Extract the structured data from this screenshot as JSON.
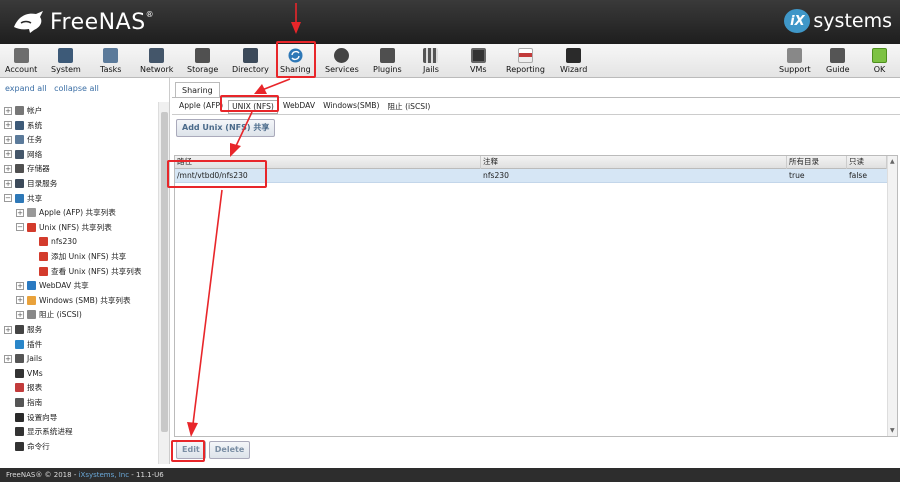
{
  "header": {
    "brand": "FreeNAS",
    "brand_tm": "®",
    "partner_mark": "iX",
    "partner_text": "systems"
  },
  "toolbar": {
    "items": [
      {
        "label": "Account",
        "icon": "account-icon",
        "color": "#6d6d6d"
      },
      {
        "label": "System",
        "icon": "system-icon",
        "color": "#3d5a78"
      },
      {
        "label": "Tasks",
        "icon": "tasks-icon",
        "color": "#5b7a9a"
      },
      {
        "label": "Network",
        "icon": "network-icon",
        "color": "#44566a"
      },
      {
        "label": "Storage",
        "icon": "storage-icon",
        "color": "#505050"
      },
      {
        "label": "Directory",
        "icon": "directory-icon",
        "color": "#3c4a5a"
      },
      {
        "label": "Sharing",
        "icon": "sharing-icon",
        "color": "#2e78b7"
      },
      {
        "label": "Services",
        "icon": "services-icon",
        "color": "#444444"
      },
      {
        "label": "Plugins",
        "icon": "plugins-icon",
        "color": "#4f4f4f"
      },
      {
        "label": "Jails",
        "icon": "jails-icon",
        "color": "#555555"
      },
      {
        "label": "VMs",
        "icon": "vms-icon",
        "color": "#333333"
      },
      {
        "label": "Reporting",
        "icon": "reporting-icon",
        "color": "#c23b3b"
      },
      {
        "label": "Wizard",
        "icon": "wizard-icon",
        "color": "#2a2a2a"
      },
      {
        "label": "Support",
        "icon": "support-icon",
        "color": "#777777"
      },
      {
        "label": "Guide",
        "icon": "guide-icon",
        "color": "#555555"
      },
      {
        "label": "OK",
        "icon": "ok-icon",
        "color": "#7cc242"
      }
    ]
  },
  "sidebar": {
    "expand_all": "expand all",
    "collapse_all": "collapse all",
    "tree": [
      {
        "label": "帐户",
        "icon": "account-icon",
        "color": "#777777",
        "expander": "+"
      },
      {
        "label": "系统",
        "icon": "system-icon",
        "color": "#3d5a78",
        "expander": "+"
      },
      {
        "label": "任务",
        "icon": "tasks-icon",
        "color": "#5b7a9a",
        "expander": "+"
      },
      {
        "label": "网络",
        "icon": "network-icon",
        "color": "#44566a",
        "expander": "+"
      },
      {
        "label": "存储器",
        "icon": "storage-icon",
        "color": "#505050",
        "expander": "+"
      },
      {
        "label": "目录服务",
        "icon": "directory-icon",
        "color": "#3c4a5a",
        "expander": "+"
      },
      {
        "label": "共享",
        "icon": "sharing-icon",
        "color": "#2e78b7",
        "expander": "−"
      },
      {
        "label": "Apple (AFP) 共享列表",
        "icon": "apple-icon",
        "color": "#999999",
        "expander": "+"
      },
      {
        "label": "Unix (NFS) 共享列表",
        "icon": "unix-icon",
        "color": "#d33b2c",
        "expander": "−"
      },
      {
        "label": "nfs230",
        "icon": "unix-share-icon",
        "color": "#d33b2c",
        "expander": ""
      },
      {
        "label": "添加 Unix (NFS) 共享",
        "icon": "add-share-icon",
        "color": "#d33b2c",
        "expander": ""
      },
      {
        "label": "查看 Unix (NFS) 共享列表",
        "icon": "view-share-icon",
        "color": "#d33b2c",
        "expander": ""
      },
      {
        "label": "WebDAV 共享",
        "icon": "webdav-icon",
        "color": "#2a7ac2",
        "expander": "+"
      },
      {
        "label": "Windows (SMB) 共享列表",
        "icon": "windows-icon",
        "color": "#e9a23b",
        "expander": "+"
      },
      {
        "label": "阻止 (iSCSI)",
        "icon": "iscsi-icon",
        "color": "#888888",
        "expander": "+"
      },
      {
        "label": "服务",
        "icon": "services-icon",
        "color": "#444444",
        "expander": "+"
      },
      {
        "label": "插件",
        "icon": "plugins-icon",
        "color": "#2a86c9",
        "expander": ""
      },
      {
        "label": "Jails",
        "icon": "jails-icon",
        "color": "#555555",
        "expander": "+"
      },
      {
        "label": "VMs",
        "icon": "vms-icon",
        "color": "#333333",
        "expander": ""
      },
      {
        "label": "报表",
        "icon": "reporting-icon",
        "color": "#c23b3b",
        "expander": ""
      },
      {
        "label": "指南",
        "icon": "guide-icon",
        "color": "#555555",
        "expander": ""
      },
      {
        "label": "设置向导",
        "icon": "wizard-icon",
        "color": "#2a2a2a",
        "expander": ""
      },
      {
        "label": "显示系统进程",
        "icon": "process-icon",
        "color": "#333333",
        "expander": ""
      },
      {
        "label": "命令行",
        "icon": "shell-icon",
        "color": "#333333",
        "expander": ""
      }
    ]
  },
  "main": {
    "tab_label": "Sharing",
    "subtabs": [
      {
        "label": "Apple (AFP)",
        "active": false
      },
      {
        "label": "UNIX (NFS)",
        "active": true
      },
      {
        "label": "WebDAV",
        "active": false
      },
      {
        "label": "Windows(SMB)",
        "active": false
      },
      {
        "label": "阻止 (iSCSI)",
        "active": false
      }
    ],
    "add_button": "Add Unix (NFS) 共享",
    "columns": [
      "路径",
      "注释",
      "所有目录",
      "只读"
    ],
    "rows": [
      [
        "/mnt/vtbd0/nfs230",
        "nfs230",
        "true",
        "false"
      ]
    ],
    "edit_button": "Edit",
    "delete_button": "Delete"
  },
  "footer": {
    "copyright": "FreeNAS® © 2018 - ",
    "company": "iXsystems, Inc",
    "version": " - 11.1-U6"
  },
  "annotation_color": "#e8262a"
}
